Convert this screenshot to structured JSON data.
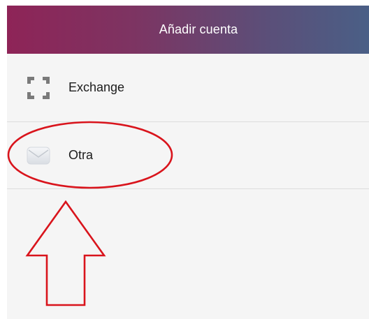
{
  "header": {
    "title": "Añadir cuenta"
  },
  "accounts": [
    {
      "label": "Exchange",
      "icon": "exchange-icon"
    },
    {
      "label": "Otra",
      "icon": "envelope-icon"
    }
  ],
  "colors": {
    "header_gradient_start": "#8e2457",
    "header_gradient_end": "#4a5f86",
    "annotation_red": "#d9141c",
    "list_background": "#f5f5f5",
    "divider": "#dcdcdc"
  }
}
